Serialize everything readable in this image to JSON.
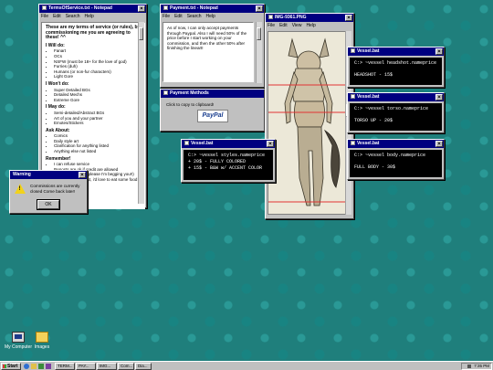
{
  "desktop": {
    "icons": [
      {
        "label": "My Computer"
      },
      {
        "label": "Images"
      }
    ]
  },
  "tos_window": {
    "title": "TermsOfService.txt - Notepad",
    "menu": [
      "File",
      "Edit",
      "Search",
      "Help"
    ],
    "intro": "These are my terms of service (or rules), by commissioning me you are agreeing to these! ^^",
    "will_do_heading": "I Will do:",
    "will_do": [
      "Fanart",
      "OCs",
      "NSFW (must be 18+ for the love of god)",
      "Furries (duh)",
      "Humans (or non-fur characters)",
      "Light Gore"
    ],
    "wont_do_heading": "I Won't do:",
    "wont_do": [
      "Super Detailed BGs",
      "Detailed Mechs",
      "Extreme Gore"
    ],
    "may_do_heading": "I May do:",
    "may_do": [
      "Semi-detailed/Abstract BGs",
      "Art of you and your partner",
      "Emotes/Stickers"
    ],
    "ask_about_heading": "Ask About:",
    "ask_about": [
      "Comics",
      "Daily style art",
      "Clarification for anything listed",
      "Anything else not listed"
    ],
    "remember_heading": "Remember!",
    "remember": [
      "I can refuse service",
      "Reposts are ok if credit are allowed",
      "Don't steal my art (please I'm begging you!!)",
      "please tip your artist, i'd love to eat some food <3"
    ]
  },
  "payment_window": {
    "title": "Payment.txt - Notepad",
    "menu": [
      "File",
      "Edit",
      "Search",
      "Help"
    ],
    "text": "As of now, I can only accept payments through Paypal. Also I will need 50% of the price before I start working on your commission, and then the other 50% after finishing the lineart!"
  },
  "payment_methods": {
    "title": "Payment Methods",
    "hint": "Click to copy to clipboard!",
    "paypal_label": "PayPal"
  },
  "image_window": {
    "title": "IMG-9361.PNG",
    "menu": [
      "File",
      "Edit",
      "View",
      "Help"
    ]
  },
  "headshot_window": {
    "title": "Vessel.bat",
    "command": "C:> ~vessel headshot.nameprice",
    "result": "HEADSHOT - 15$"
  },
  "torso_window": {
    "title": "Vessel.bat",
    "command": "C:> ~vessel torso.nameprice",
    "result": "TORSO UP - 20$"
  },
  "styles_window": {
    "title": "Vessel.bat",
    "command": "C:> ~vessel styles.nameprice",
    "lines": [
      "+ 20$ - FULLY COLORED",
      "+ 15$ - B&W w/ ACCENT COLOR"
    ]
  },
  "body_window": {
    "title": "Vessel.bat",
    "command": "C:> ~vessel body.nameprice",
    "result": "FULL BODY - 30$"
  },
  "warning_dialog": {
    "title": "Warning",
    "message": "Commissions are currently closed Come back later!",
    "ok_label": "OK"
  },
  "taskbar": {
    "start_label": "Start",
    "buttons": [
      "TERM...",
      "PAY...",
      "IMG...",
      "Com...",
      "Dia..."
    ],
    "clock": "7:35 PM"
  },
  "colors": {
    "desktop": "#1f7f7c",
    "title_bar": "#000080",
    "guide_line": "#e23333"
  }
}
